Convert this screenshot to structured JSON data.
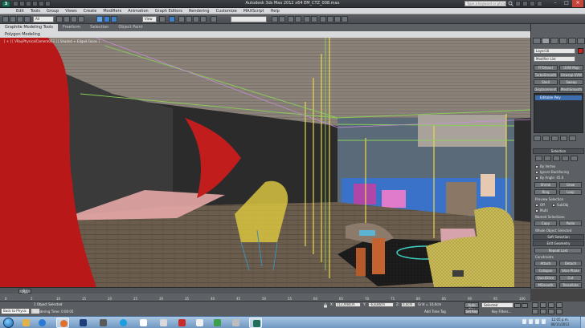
{
  "window": {
    "title": "Autodesk 3ds Max  2012 x64      EM_CTZ_008.max",
    "search_placeholder": "Type a keyword or phrase"
  },
  "menu": [
    "Edit",
    "Tools",
    "Group",
    "Views",
    "Create",
    "Modifiers",
    "Animation",
    "Graph Editors",
    "Rendering",
    "Customize",
    "MAXScript",
    "Help"
  ],
  "toolbar": {
    "selection_filter": "All",
    "reference_coord": "View"
  },
  "ribbon": {
    "tabs": [
      "Graphite Modeling Tools",
      "Freeform",
      "Selection",
      "Object Paint"
    ],
    "active_panel": "Polygon Modeling"
  },
  "viewport": {
    "label": "[ + ] [ VRayPhysicalCamera003 ] [ Shaded + Edged Faces ]"
  },
  "command_panel": {
    "object_name": "Layer16",
    "modifier_list": "Modifier List",
    "modifier_buttons": [
      "FFD(box)",
      "UVW Map",
      "TurboSmooth",
      "Unwrap UVW",
      "Shell",
      "Sweep",
      "Displacement",
      "MeshSmooth"
    ],
    "stack_item": "Editable Poly",
    "selection_rollout": "Selection",
    "checkboxes": [
      "By Vertex",
      "Ignore Backfacing",
      "By Angle: 45.0",
      "Shrink",
      "Grow",
      "Ring",
      "Loop",
      "Preview Selection",
      "Off",
      "SubObj",
      "Multi"
    ],
    "named_selections": "Named Selections:",
    "copy_label": "Copy",
    "paste_label": "Paste",
    "whole_object": "Whole Object Selected",
    "soft_selection": "Soft Selection",
    "edit_geometry": "Edit Geometry",
    "repeat_last": "Repeat Last",
    "constraints": "Constraints",
    "attach": "Attach",
    "detach": "Detach",
    "collapse": "Collapse",
    "slice_plane": "Slice Plane",
    "quickslice": "QuickSlice",
    "cut": "Cut",
    "msmooth": "MSmooth",
    "tessellate": "Tessellate",
    "make_planar": "Make Planar",
    "relax": "Relax",
    "hide_sel": "Hide Selected"
  },
  "timeline": {
    "slider_label": "0 / 100",
    "ticks": [
      "0",
      "5",
      "10",
      "15",
      "20",
      "25",
      "30",
      "35",
      "40",
      "45",
      "50",
      "55",
      "60",
      "65",
      "70",
      "75",
      "80",
      "85",
      "90",
      "95",
      "100"
    ]
  },
  "status": {
    "maxscript": "Back to Physic",
    "selection": "1 Object Selected",
    "rendering_time": "Rendering Time: 0:00:05",
    "x_label": "X:",
    "x_value": "112,944cm",
    "y_label": "Y:",
    "y_value": "-6,838cm",
    "z_label": "Z:",
    "z_value": "0,0cm",
    "grid": "Grid = 10,0cm",
    "add_time_tag": "Add Time Tag",
    "auto_key": "Auto Key",
    "set_key": "Set Key",
    "key_mode": "Selected",
    "key_filters": "Key Filters..."
  },
  "taskbar": {
    "time": "12:05 p.m.",
    "date": "06/11/2012"
  },
  "colors": {
    "accent": "#3e7fc9",
    "curtain": "#c01818",
    "floor": "#6d5c4a",
    "wire_yellow": "#e8d84a"
  }
}
